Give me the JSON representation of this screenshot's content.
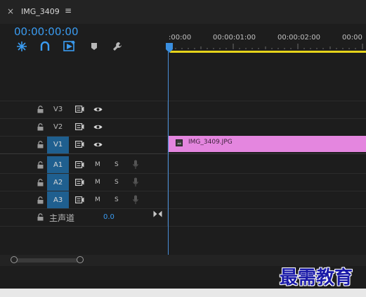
{
  "panel": {
    "close_glyph": "×",
    "title": "IMG_3409",
    "menu_glyph": "≡"
  },
  "timecode": "00:00:00:00",
  "ruler": {
    "ticks": [
      ":00:00",
      "00:00:01:00",
      "00:00:02:00",
      "00:00"
    ]
  },
  "toolbar_icons": [
    "snap-icon",
    "linked-selection-icon",
    "insert-icon",
    "marker-icon",
    "wrench-icon"
  ],
  "video_tracks": [
    {
      "label": "V3",
      "targeted": false
    },
    {
      "label": "V2",
      "targeted": false
    },
    {
      "label": "V1",
      "targeted": true
    }
  ],
  "audio_tracks": [
    {
      "label": "A1",
      "mute": "M",
      "solo": "S"
    },
    {
      "label": "A2",
      "mute": "M",
      "solo": "S"
    },
    {
      "label": "A3",
      "mute": "M",
      "solo": "S"
    }
  ],
  "master": {
    "label": "主声道",
    "value": "0.0"
  },
  "clip": {
    "name": "IMG_3409.JPG",
    "color": "#e486df"
  },
  "watermark": "最需教育",
  "colors": {
    "accent": "#3a9bf0",
    "clip": "#e486df",
    "track_target": "#1f5f8f",
    "playhead": "#4a8fd8",
    "work_area": "#e6d31a"
  }
}
